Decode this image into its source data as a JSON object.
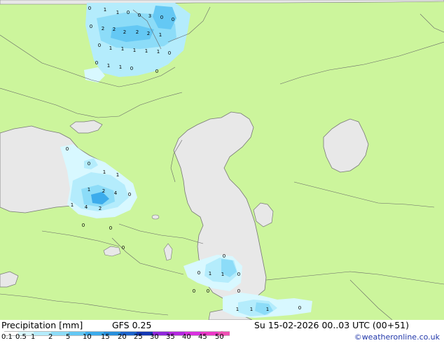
{
  "footer": {
    "title": "Precipitation [mm]",
    "model": "GFS 0.25",
    "valid_time": "Su 15-02-2026 00..03 UTC (00+51)",
    "credit": "©weatheronline.co.uk"
  },
  "legend": {
    "ticks": [
      "0.1",
      "0.5",
      "1",
      "2",
      "5",
      "10",
      "15",
      "20",
      "25",
      "30",
      "35",
      "40",
      "45",
      "50"
    ],
    "colors": [
      "#ffffff",
      "#d8f8ff",
      "#b4ecfc",
      "#8cdcf8",
      "#64c8f4",
      "#3cacec",
      "#2890dc",
      "#1c64cc",
      "#1438b4",
      "#9028dc",
      "#b428e0",
      "#d830e0",
      "#ec38c8",
      "#f050b4"
    ]
  },
  "map": {
    "land_color": "#ccf59c",
    "sea_color": "#e8e8e8",
    "value_labels": [
      "0",
      "1",
      "1",
      "0",
      "0",
      "3",
      "0",
      "0",
      "0",
      "2",
      "2",
      "2",
      "2",
      "2",
      "1",
      "0",
      "1",
      "1",
      "1",
      "1",
      "1",
      "0",
      "0",
      "1",
      "1",
      "0",
      "0",
      "0",
      "0",
      "1",
      "1",
      "1",
      "2",
      "4",
      "0",
      "1",
      "4",
      "2",
      "0",
      "0",
      "0",
      "0",
      "0",
      "1",
      "1",
      "0",
      "0",
      "0",
      "0",
      "1",
      "1",
      "1",
      "0"
    ]
  }
}
